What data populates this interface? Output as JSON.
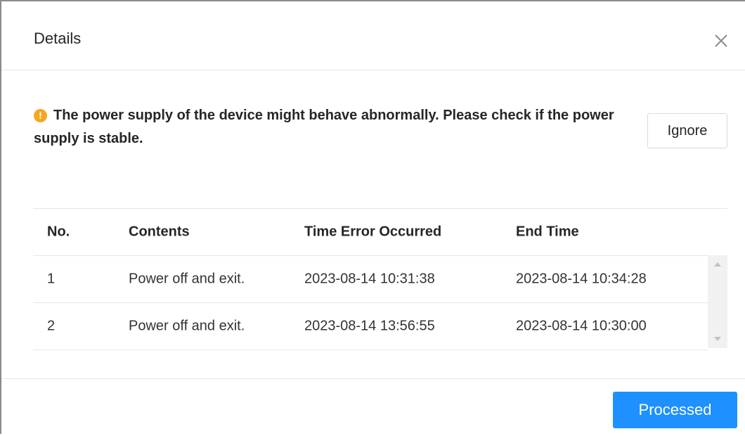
{
  "dialog": {
    "title": "Details",
    "close_icon": "close-icon"
  },
  "notice": {
    "icon": "warning-icon",
    "icon_glyph": "!",
    "icon_color": "#f5a623",
    "text": "The power supply of the device might behave abnormally. Please check if the power supply is stable."
  },
  "buttons": {
    "ignore": "Ignore",
    "processed": "Processed",
    "processed_color": "#1e90ff"
  },
  "table": {
    "columns": [
      "No.",
      "Contents",
      "Time Error Occurred",
      "End Time"
    ],
    "rows": [
      [
        "1",
        "Power off and exit.",
        "2023-08-14 10:31:38",
        "2023-08-14 10:34:28"
      ],
      [
        "2",
        "Power off and exit.",
        "2023-08-14 13:56:55",
        "2023-08-14 10:30:00"
      ]
    ]
  }
}
